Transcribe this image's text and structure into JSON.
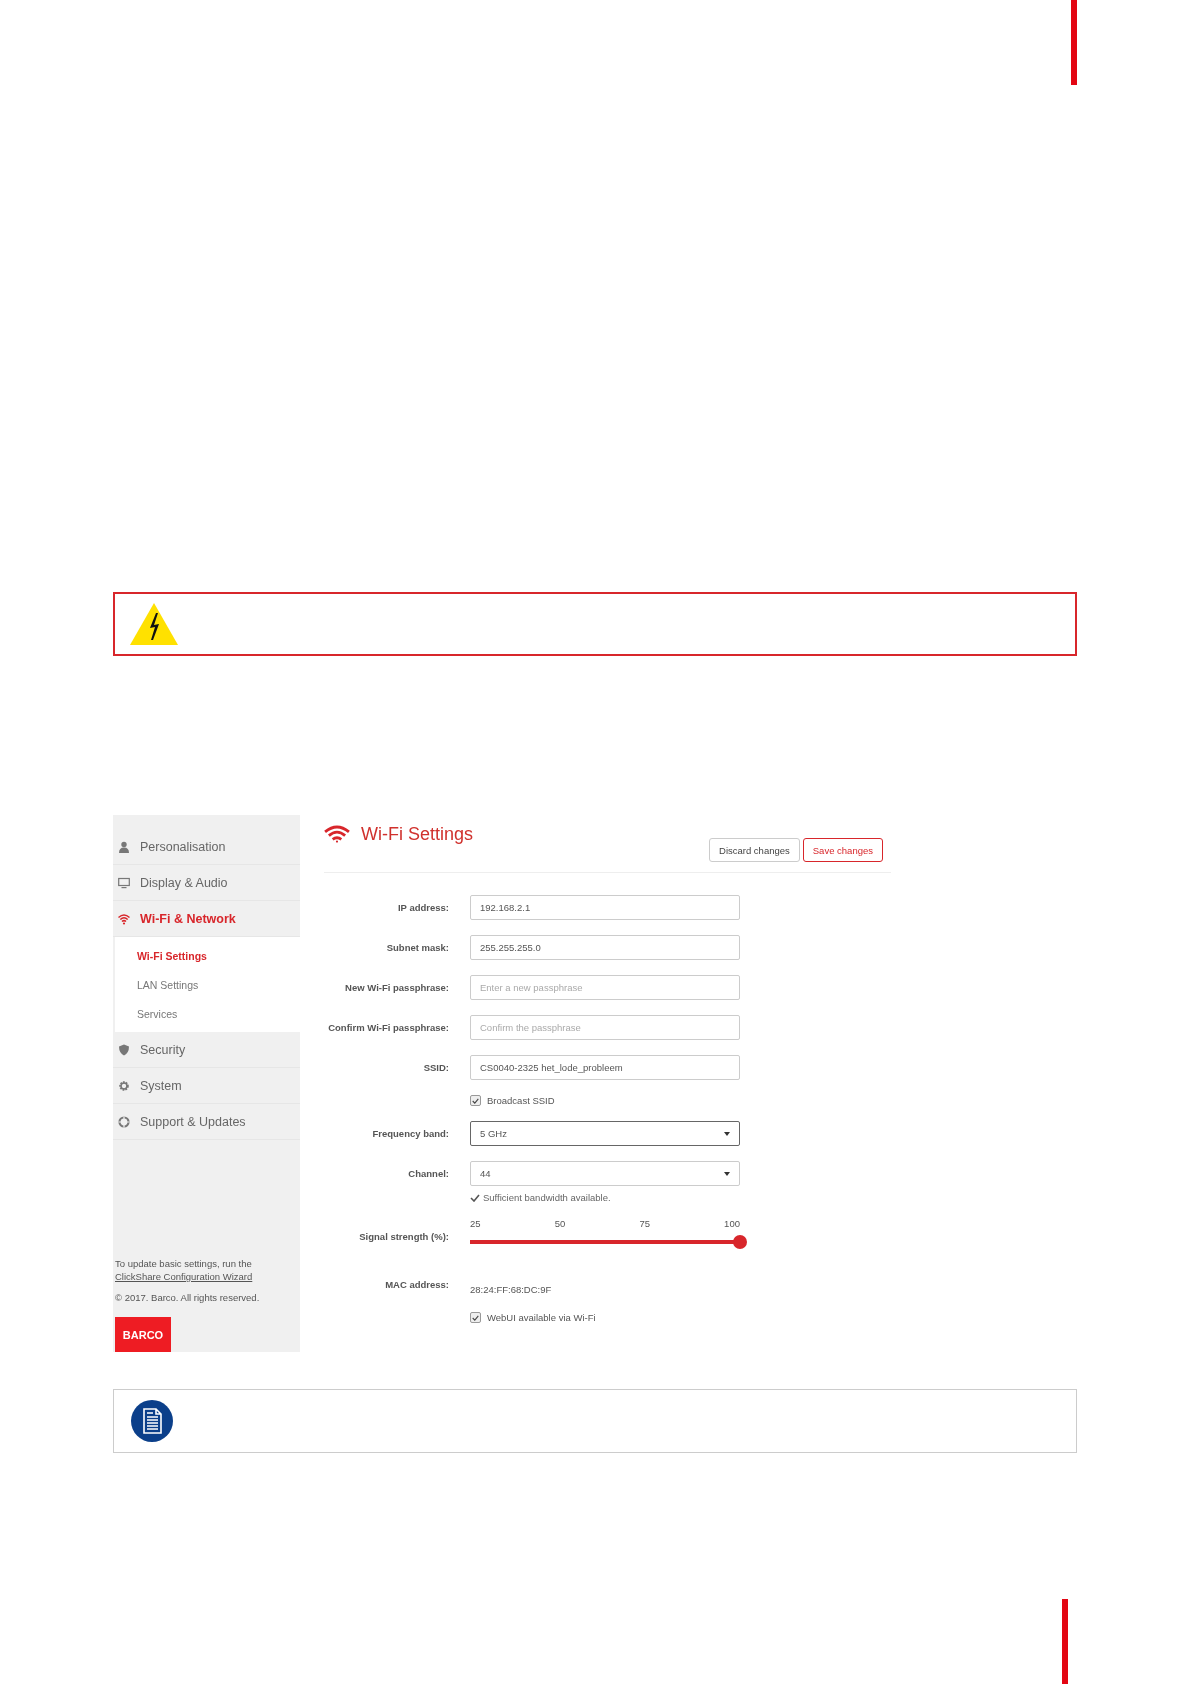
{
  "sidebar": {
    "items": [
      {
        "label": "Personalisation",
        "selected": false
      },
      {
        "label": "Display & Audio",
        "selected": false
      },
      {
        "label": "Wi-Fi & Network",
        "selected": true,
        "children": [
          {
            "label": "Wi-Fi Settings",
            "selected": true
          },
          {
            "label": "LAN Settings",
            "selected": false
          },
          {
            "label": "Services",
            "selected": false
          }
        ]
      },
      {
        "label": "Security",
        "selected": false
      },
      {
        "label": "System",
        "selected": false
      },
      {
        "label": "Support & Updates",
        "selected": false
      }
    ],
    "footer_text": "To update basic settings, run the",
    "footer_link": "ClickShare Configuration Wizard",
    "copyright": "© 2017. Barco. All rights reserved.",
    "logo": "BARCO"
  },
  "header": {
    "title": "Wi-Fi Settings",
    "buttons": [
      {
        "label": "Discard changes",
        "kind": "secondary"
      },
      {
        "label": "Save changes",
        "kind": "primary"
      }
    ]
  },
  "form": [
    {
      "kind": "text",
      "label": "IP address:",
      "value": "192.168.2.1"
    },
    {
      "kind": "text",
      "label": "Subnet mask:",
      "value": "255.255.255.0"
    },
    {
      "kind": "text",
      "label": "New Wi-Fi passphrase:",
      "placeholder": "Enter a new passphrase"
    },
    {
      "kind": "text",
      "label": "Confirm Wi-Fi passphrase:",
      "placeholder": "Confirm the passphrase"
    },
    {
      "kind": "text",
      "label": "SSID:",
      "value": "CS0040-2325 het_lode_probleem"
    },
    {
      "kind": "checkbox",
      "label": "Broadcast SSID",
      "checked": true
    },
    {
      "kind": "select",
      "label": "Frequency band:",
      "value": "5 GHz",
      "focused": true
    },
    {
      "kind": "select",
      "label": "Channel:",
      "value": "44",
      "focused": false,
      "hint": "Sufficient bandwidth available."
    },
    {
      "kind": "slider",
      "label": "Signal strength (%):",
      "ticks": [
        "25",
        "50",
        "75",
        "100"
      ],
      "level": 1
    },
    {
      "kind": "static",
      "label": "MAC address:",
      "value": "28:24:FF:68:DC:9F"
    },
    {
      "kind": "checkbox",
      "label": "WebUI available via Wi-Fi",
      "checked": true
    }
  ]
}
